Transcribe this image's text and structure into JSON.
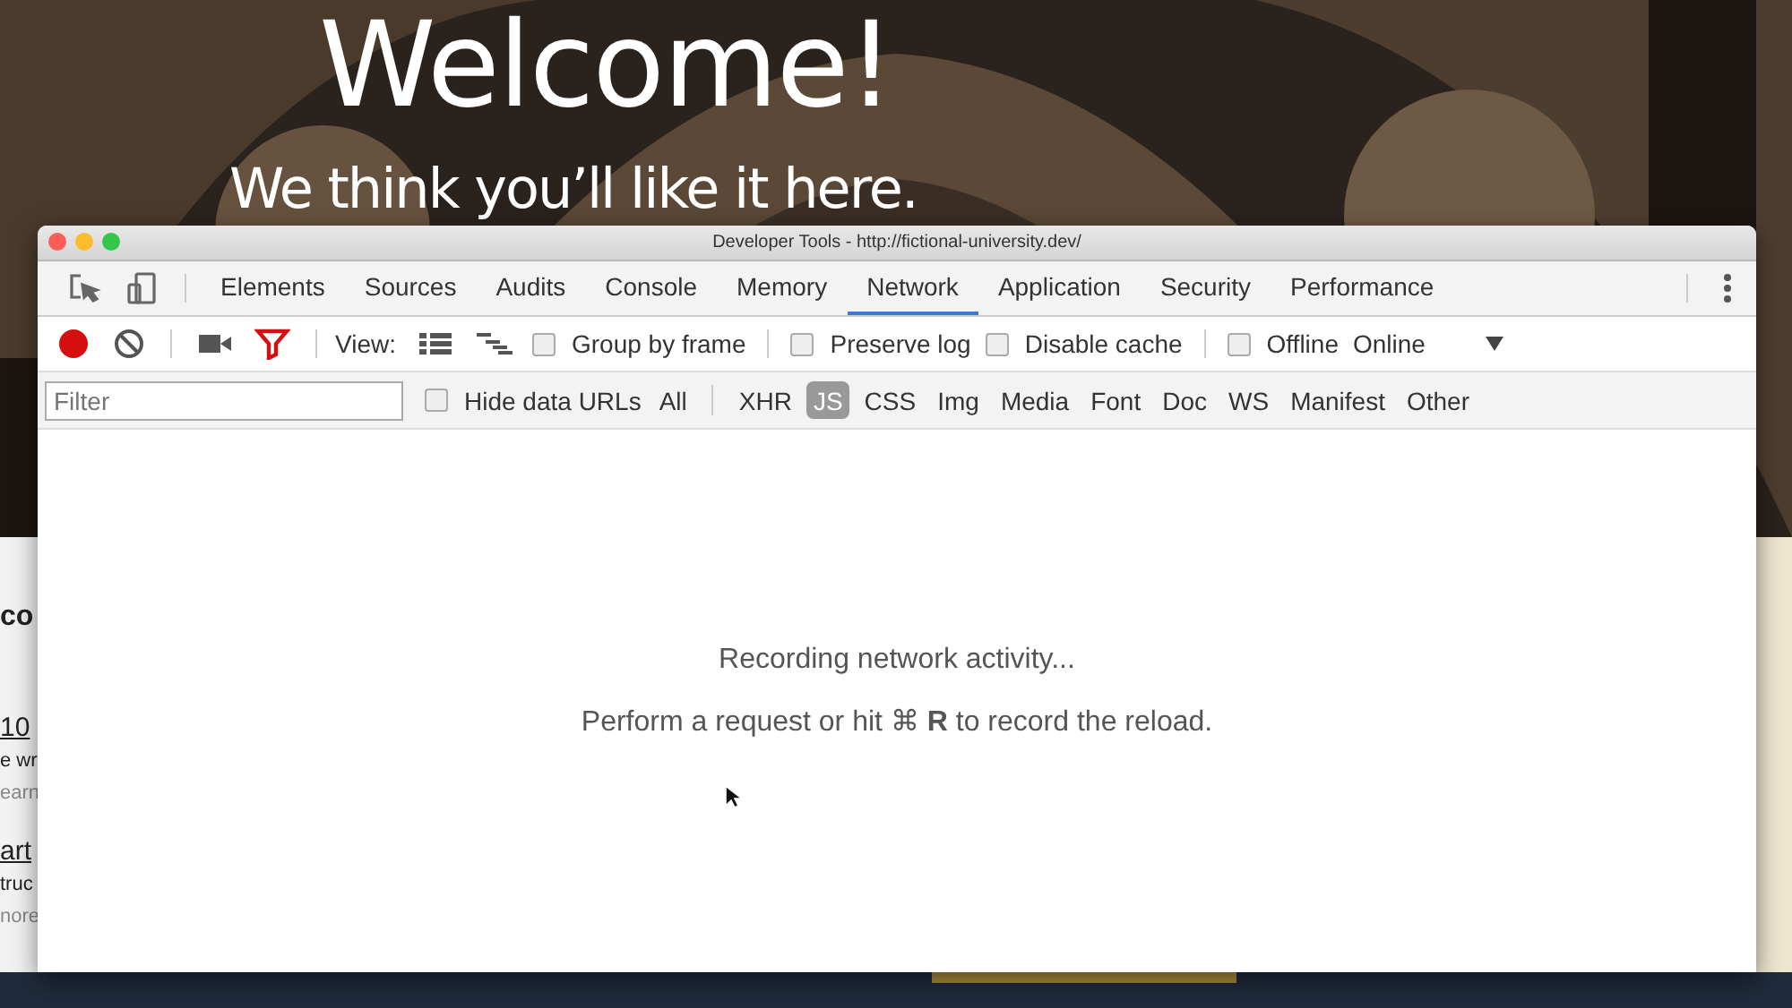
{
  "page": {
    "heading": "Welcome!",
    "subheading": "We think you’ll like it here.",
    "side_texts": [
      {
        "text": "co",
        "kind": "heading"
      },
      {
        "text": "10",
        "kind": "link"
      },
      {
        "text": "e wr",
        "kind": "body"
      },
      {
        "text": "earn",
        "kind": "muted"
      },
      {
        "text": "art",
        "kind": "link"
      },
      {
        "text": "truc",
        "kind": "body"
      },
      {
        "text": "nore",
        "kind": "muted"
      }
    ]
  },
  "window": {
    "title": "Developer Tools - http://fictional-university.dev/"
  },
  "tabs": [
    {
      "label": "Elements",
      "selected": false
    },
    {
      "label": "Sources",
      "selected": false
    },
    {
      "label": "Audits",
      "selected": false
    },
    {
      "label": "Console",
      "selected": false
    },
    {
      "label": "Memory",
      "selected": false
    },
    {
      "label": "Network",
      "selected": true
    },
    {
      "label": "Application",
      "selected": false
    },
    {
      "label": "Security",
      "selected": false
    },
    {
      "label": "Performance",
      "selected": false
    }
  ],
  "toolbar": {
    "recording": true,
    "filter_on": true,
    "view_label": "View:",
    "options": [
      {
        "label": "Group by frame",
        "checked": false
      },
      {
        "label": "Preserve log",
        "checked": false
      },
      {
        "label": "Disable cache",
        "checked": false
      },
      {
        "label": "Offline",
        "checked": false
      }
    ],
    "throttling": "Online"
  },
  "filter_bar": {
    "placeholder": "Filter",
    "hide_data_urls": {
      "label": "Hide data URLs",
      "checked": false
    },
    "types": [
      {
        "label": "All",
        "selected": false
      },
      {
        "label": "XHR",
        "selected": false
      },
      {
        "label": "JS",
        "selected": true
      },
      {
        "label": "CSS",
        "selected": false
      },
      {
        "label": "Img",
        "selected": false
      },
      {
        "label": "Media",
        "selected": false
      },
      {
        "label": "Font",
        "selected": false
      },
      {
        "label": "Doc",
        "selected": false
      },
      {
        "label": "WS",
        "selected": false
      },
      {
        "label": "Manifest",
        "selected": false
      },
      {
        "label": "Other",
        "selected": false
      }
    ]
  },
  "content": {
    "status": "Recording network activity...",
    "hint": "Perform a request or hit ⌘ **R** to record the reload."
  }
}
